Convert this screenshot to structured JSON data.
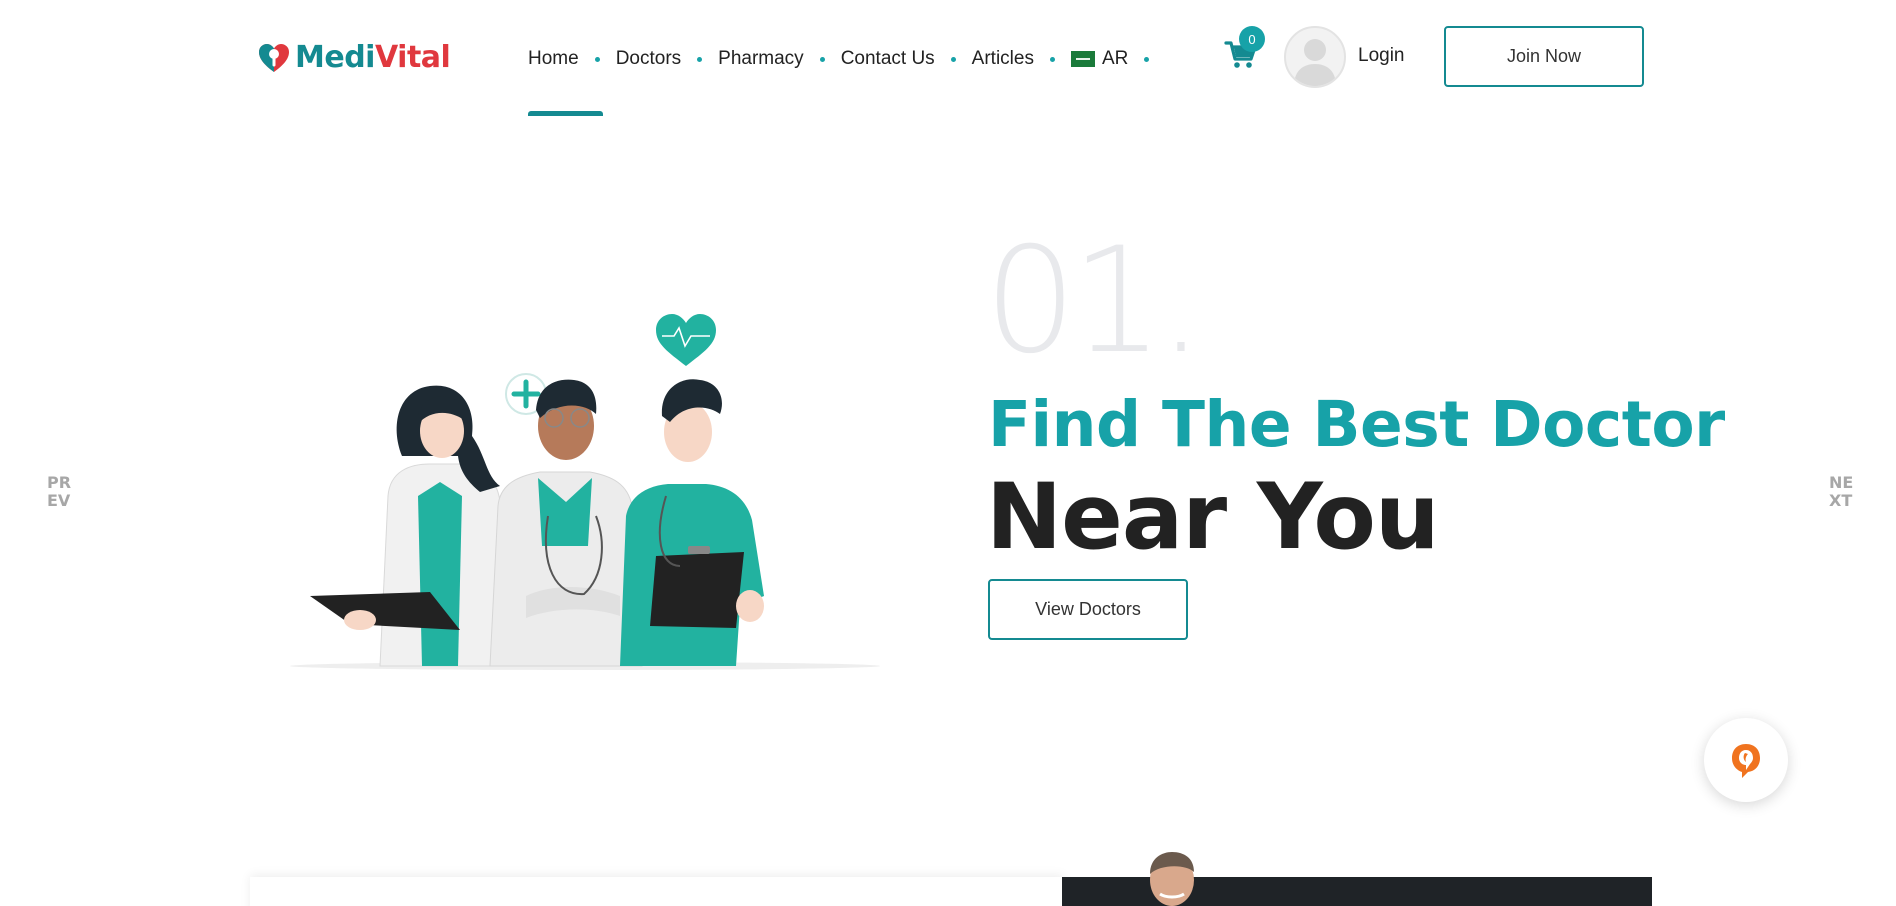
{
  "brand": {
    "name_part1": "Medi",
    "name_part2": "Vital",
    "primary_color": "#148a91",
    "accent_color": "#e0383e"
  },
  "nav": {
    "items": [
      {
        "label": "Home",
        "active": true
      },
      {
        "label": "Doctors"
      },
      {
        "label": "Pharmacy"
      },
      {
        "label": "Contact Us"
      },
      {
        "label": "Articles"
      }
    ],
    "language": {
      "label": "AR",
      "flag": "saudi-flag-icon"
    }
  },
  "cart": {
    "count": "0",
    "icon": "cart-icon"
  },
  "user": {
    "login_label": "Login",
    "avatar": "user-avatar-icon"
  },
  "join": {
    "label": "Join Now"
  },
  "hero": {
    "slide_number": "01.",
    "title": "Find The Best Doctor",
    "subtitle": "Near You",
    "button_label": "View Doctors",
    "illustration": "doctors-team-illustration"
  },
  "slider": {
    "prev_label": "PREV",
    "next_label": "NEXT"
  },
  "chat": {
    "icon": "chat-support-icon",
    "color": "#f0731f"
  }
}
